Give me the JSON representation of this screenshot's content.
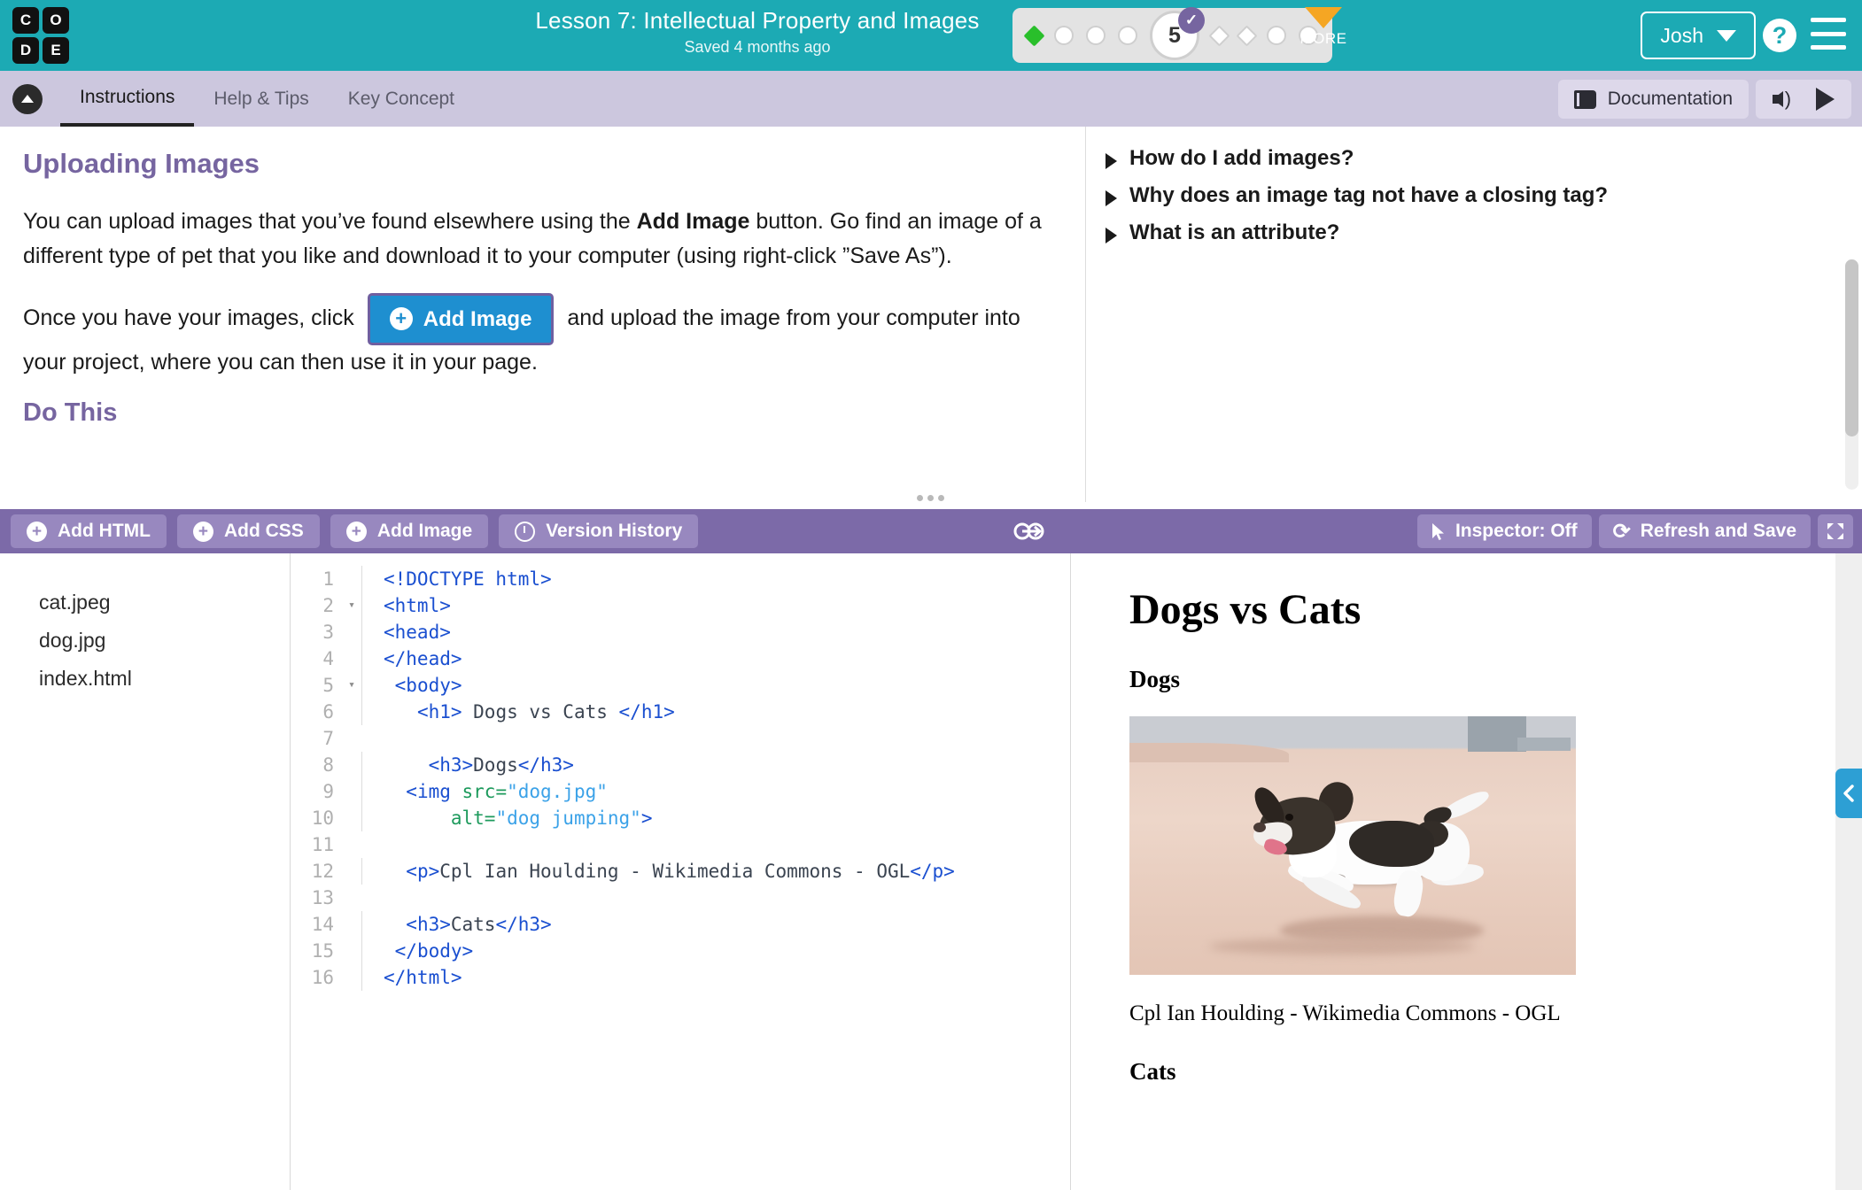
{
  "header": {
    "logo_letters": [
      "C",
      "O",
      "D",
      "E"
    ],
    "lesson_title": "Lesson 7: Intellectual Property and Images",
    "saved_status": "Saved 4 months ago",
    "progress": {
      "current_level": "5",
      "bubbles": [
        "diamond-filled",
        "circle",
        "circle",
        "circle",
        "current",
        "diamond-open",
        "diamond-open",
        "circle",
        "circle"
      ],
      "accent_green": "#29bf2b",
      "check_purple": "#7665a0"
    },
    "more_label": "MORE",
    "user_name": "Josh",
    "help_glyph": "?",
    "teal": "#1caab4"
  },
  "instruction_tabs": {
    "items": [
      {
        "label": "Instructions",
        "active": true
      },
      {
        "label": "Help & Tips",
        "active": false
      },
      {
        "label": "Key Concept",
        "active": false
      }
    ],
    "documentation_label": "Documentation"
  },
  "instructions": {
    "heading": "Uploading Images",
    "para1_a": "You can upload images that you’ve found elsewhere using the ",
    "para1_bold": "Add Image",
    "para1_b": " button. Go find an image of a different type of pet that you like and download it to your computer (using right-click ”Save As”).",
    "para2_a": "Once you have your images, click",
    "add_image_button": "Add Image",
    "para2_b": "and upload the image from your computer into your project, where you can then use it in your page.",
    "do_this": "Do This",
    "questions": [
      "How do I add images?",
      "Why does an image tag not have a closing tag?",
      "What is an attribute?"
    ],
    "heading_color": "#7665a0"
  },
  "editor_toolbar": {
    "buttons": [
      {
        "label": "Add HTML",
        "icon": "plus-circle-icon"
      },
      {
        "label": "Add CSS",
        "icon": "plus-circle-icon"
      },
      {
        "label": "Add Image",
        "icon": "plus-circle-icon"
      },
      {
        "label": "Version History",
        "icon": "clock-icon"
      }
    ],
    "inspector_label": "Inspector: Off",
    "refresh_label": "Refresh and Save",
    "bar_color": "#7c6aa8"
  },
  "files": [
    "cat.jpeg",
    "dog.jpg",
    "index.html"
  ],
  "code": {
    "lines": [
      {
        "n": "1",
        "fold": "",
        "parts": [
          {
            "t": "tg",
            "s": "<!DOCTYPE html>"
          }
        ]
      },
      {
        "n": "2",
        "fold": "▾",
        "parts": [
          {
            "t": "tg",
            "s": "<html>"
          }
        ]
      },
      {
        "n": "3",
        "fold": "",
        "parts": [
          {
            "t": "tg",
            "s": "<head>"
          }
        ]
      },
      {
        "n": "4",
        "fold": "",
        "parts": [
          {
            "t": "tg",
            "s": "</head>"
          }
        ]
      },
      {
        "n": "5",
        "fold": "▾",
        "parts": [
          {
            "t": "tx",
            "s": " "
          },
          {
            "t": "tg",
            "s": "<body>"
          }
        ]
      },
      {
        "n": "6",
        "fold": "",
        "parts": [
          {
            "t": "tx",
            "s": "   "
          },
          {
            "t": "tg",
            "s": "<h1>"
          },
          {
            "t": "tx",
            "s": " Dogs vs Cats "
          },
          {
            "t": "tg",
            "s": "</h1>"
          }
        ]
      },
      {
        "n": "7",
        "fold": "",
        "parts": [
          {
            "t": "tx",
            "s": ""
          }
        ]
      },
      {
        "n": "8",
        "fold": "",
        "parts": [
          {
            "t": "tx",
            "s": "    "
          },
          {
            "t": "tg",
            "s": "<h3>"
          },
          {
            "t": "tx",
            "s": "Dogs"
          },
          {
            "t": "tg",
            "s": "</h3>"
          }
        ]
      },
      {
        "n": "9",
        "fold": "",
        "parts": [
          {
            "t": "tx",
            "s": "  "
          },
          {
            "t": "tg",
            "s": "<img "
          },
          {
            "t": "at",
            "s": "src="
          },
          {
            "t": "av",
            "s": "\"dog.jpg\""
          }
        ]
      },
      {
        "n": "10",
        "fold": "",
        "parts": [
          {
            "t": "tx",
            "s": "      "
          },
          {
            "t": "at",
            "s": "alt="
          },
          {
            "t": "av",
            "s": "\"dog jumping\""
          },
          {
            "t": "tg",
            "s": ">"
          }
        ]
      },
      {
        "n": "11",
        "fold": "",
        "parts": [
          {
            "t": "tx",
            "s": ""
          }
        ]
      },
      {
        "n": "12",
        "fold": "",
        "parts": [
          {
            "t": "tx",
            "s": "  "
          },
          {
            "t": "tg",
            "s": "<p>"
          },
          {
            "t": "tx",
            "s": "Cpl Ian Houlding - Wikimedia Commons - OGL"
          },
          {
            "t": "tg",
            "s": "</p>"
          }
        ]
      },
      {
        "n": "13",
        "fold": "",
        "parts": [
          {
            "t": "tx",
            "s": ""
          }
        ]
      },
      {
        "n": "14",
        "fold": "",
        "parts": [
          {
            "t": "tx",
            "s": "  "
          },
          {
            "t": "tg",
            "s": "<h3>"
          },
          {
            "t": "tx",
            "s": "Cats"
          },
          {
            "t": "tg",
            "s": "</h3>"
          }
        ]
      },
      {
        "n": "15",
        "fold": "",
        "parts": [
          {
            "t": "tx",
            "s": " "
          },
          {
            "t": "tg",
            "s": "</body>"
          }
        ]
      },
      {
        "n": "16",
        "fold": "",
        "parts": [
          {
            "t": "tg",
            "s": "</html>"
          }
        ]
      }
    ]
  },
  "preview": {
    "h1": "Dogs vs Cats",
    "h3_dogs": "Dogs",
    "image_alt": "dog jumping",
    "caption": "Cpl Ian Houlding - Wikimedia Commons - OGL",
    "h3_cats": "Cats"
  }
}
